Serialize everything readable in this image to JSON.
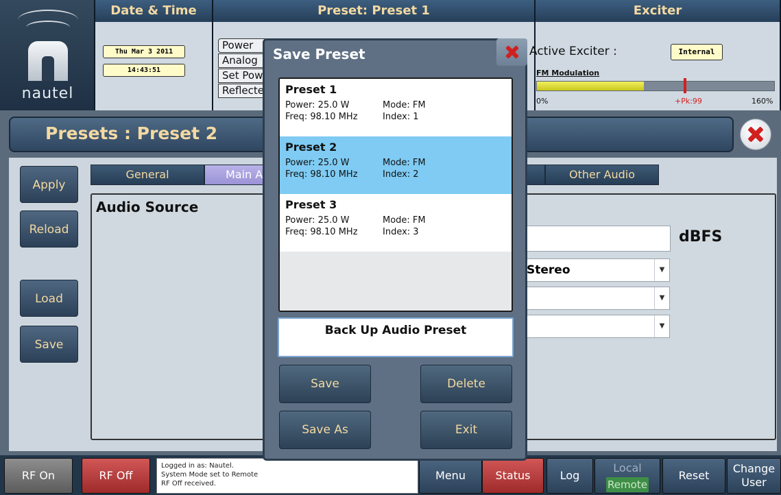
{
  "header": {
    "logo_text": "nautel",
    "datetime": {
      "title": "Date & Time",
      "date": "Thu Mar 3 2011",
      "time": "14:43:51"
    },
    "preset": {
      "title": "Preset: Preset 1",
      "buttons": [
        "Power",
        "Analog",
        "Set Power",
        "Reflected"
      ]
    },
    "exciter": {
      "title": "Exciter",
      "active_label": "Active Exciter :",
      "active_value": "Internal",
      "fm_label": "FM Modulation",
      "fm_min": "0%",
      "fm_peak": "+Pk:99",
      "fm_max": "160%",
      "fm_level_fraction": 0.45,
      "fm_peak_fraction": 0.62
    }
  },
  "page": {
    "title": "Presets : Preset 2",
    "side_buttons": {
      "apply": "Apply",
      "reload": "Reload",
      "load": "Load",
      "save": "Save"
    },
    "tabs": {
      "general": "General",
      "main": "Main Audio",
      "other": "Other Audio"
    },
    "section_title": "Audio Source",
    "dbfs_unit": "dBFS",
    "dropdown_1": "Stereo",
    "dropdown_2": "",
    "dropdown_3": ""
  },
  "modal": {
    "title": "Save Preset",
    "presets": [
      {
        "name": "Preset 1",
        "power": "Power: 25.0 W",
        "mode": "Mode: FM",
        "freq": "Freq: 98.10 MHz",
        "index": "Index: 1"
      },
      {
        "name": "Preset 2",
        "power": "Power: 25.0 W",
        "mode": "Mode: FM",
        "freq": "Freq: 98.10 MHz",
        "index": "Index: 2"
      },
      {
        "name": "Preset 3",
        "power": "Power: 25.0 W",
        "mode": "Mode: FM",
        "freq": "Freq: 98.10 MHz",
        "index": "Index: 3"
      }
    ],
    "selected_index": 1,
    "name_value": "Back Up Audio Preset",
    "buttons": {
      "save": "Save",
      "delete": "Delete",
      "save_as": "Save As",
      "exit": "Exit"
    }
  },
  "bottom": {
    "rf_on": "RF On",
    "rf_off": "RF Off",
    "status_lines": [
      "Logged in as:   Nautel.",
      "System Mode set to Remote",
      "RF Off received."
    ],
    "menu": "Menu",
    "status": "Status",
    "log": "Log",
    "local": "Local",
    "remote": "Remote",
    "reset": "Reset",
    "change_user": "Change User"
  },
  "colors": {
    "accent_text": "#f3d9a2",
    "rf_off": "#b83d3d",
    "selected_row": "#7fcbf3",
    "remote_active": "#3e8e47"
  }
}
